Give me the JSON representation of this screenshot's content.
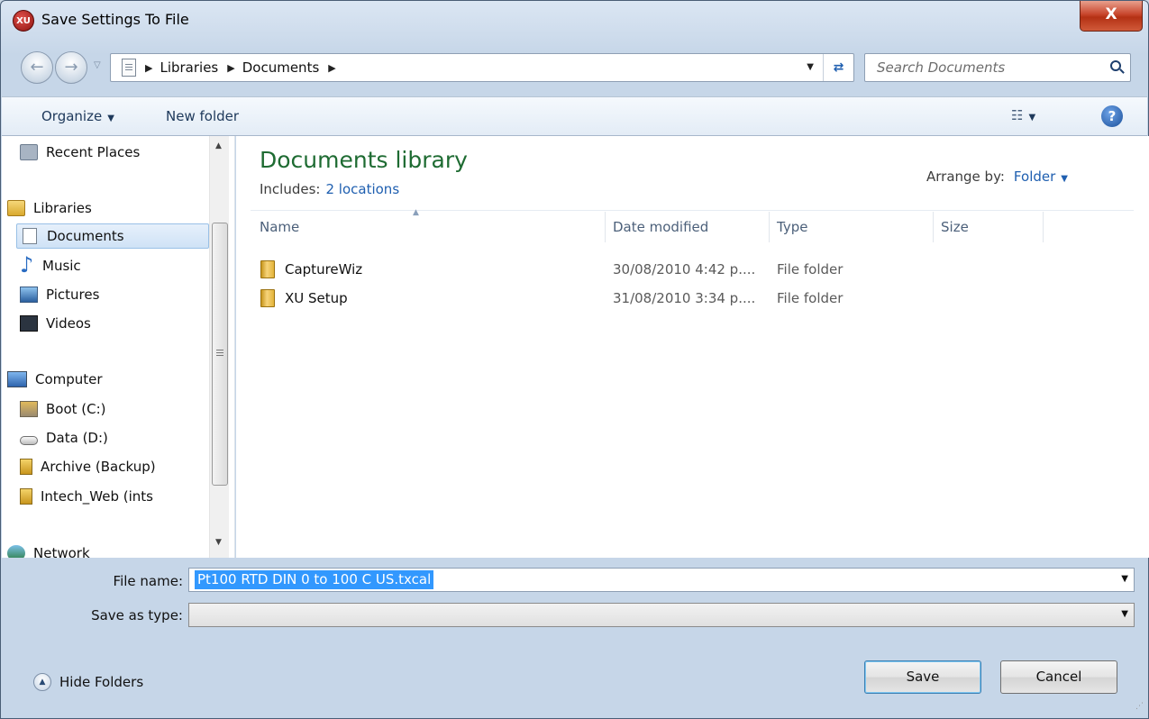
{
  "window": {
    "title": "Save Settings To File",
    "app_icon_text": "XU",
    "close_symbol": "X"
  },
  "address_bar": {
    "breadcrumbs": [
      "Libraries",
      "Documents"
    ],
    "search_placeholder": "Search Documents"
  },
  "command_bar": {
    "organize_label": "Organize",
    "new_folder_label": "New folder"
  },
  "nav_pane": {
    "items": [
      {
        "label": "Recent Places",
        "icon": "recent-places-icon"
      },
      {
        "label": "Libraries",
        "icon": "libraries-icon"
      },
      {
        "label": "Documents",
        "icon": "documents-icon",
        "selected": true
      },
      {
        "label": "Music",
        "icon": "music-icon"
      },
      {
        "label": "Pictures",
        "icon": "pictures-icon"
      },
      {
        "label": "Videos",
        "icon": "videos-icon"
      },
      {
        "label": "Computer",
        "icon": "computer-icon"
      },
      {
        "label": "Boot (C:)",
        "icon": "drive-icon"
      },
      {
        "label": "Data (D:)",
        "icon": "drive-icon"
      },
      {
        "label": "Archive (Backup)",
        "icon": "network-drive-icon"
      },
      {
        "label": "Intech_Web (ints",
        "icon": "network-drive-icon"
      },
      {
        "label": "Network",
        "icon": "network-icon"
      }
    ]
  },
  "library": {
    "title": "Documents library",
    "includes_label": "Includes:",
    "includes_link": "2 locations",
    "arrange_label": "Arrange by:",
    "arrange_value": "Folder"
  },
  "columns": {
    "name": "Name",
    "date": "Date modified",
    "type": "Type",
    "size": "Size"
  },
  "files": [
    {
      "name": "CaptureWiz",
      "date": "30/08/2010 4:42 p....",
      "type": "File folder"
    },
    {
      "name": "XU Setup",
      "date": "31/08/2010 3:34 p....",
      "type": "File folder"
    }
  ],
  "form": {
    "file_name_label": "File name:",
    "file_name_value": "Pt100 RTD DIN 0 to 100 C US.txcal",
    "save_as_type_label": "Save as type:",
    "save_as_type_value": ""
  },
  "footer": {
    "hide_folders_label": "Hide Folders",
    "save_label": "Save",
    "cancel_label": "Cancel"
  }
}
